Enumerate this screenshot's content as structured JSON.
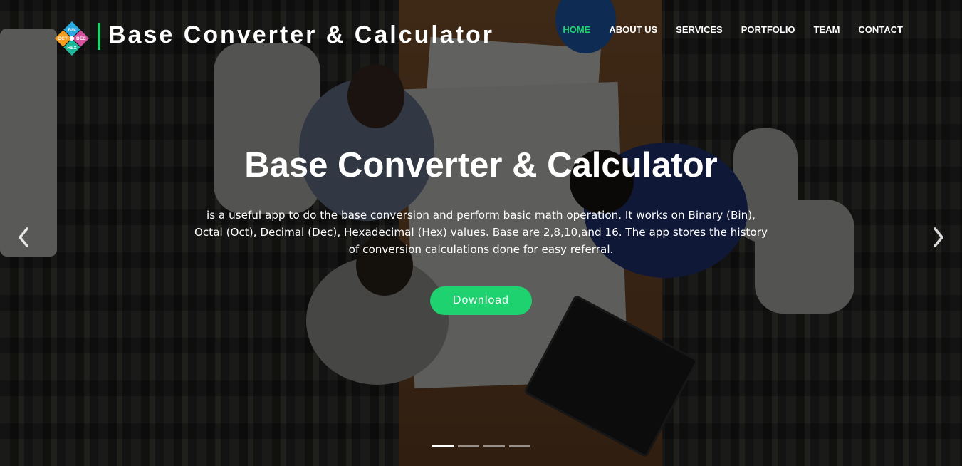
{
  "header": {
    "brand": "Base Converter & Calculator",
    "logo": {
      "labels": [
        "BIN",
        "OCT",
        "DEC",
        "HEX"
      ],
      "colors": [
        "#29a9e1",
        "#f39c1e",
        "#d4509b",
        "#1bb89a"
      ]
    },
    "accent_color": "#1ed36f"
  },
  "nav": {
    "items": [
      {
        "label": "HOME",
        "active": true
      },
      {
        "label": "ABOUT US",
        "active": false
      },
      {
        "label": "SERVICES",
        "active": false
      },
      {
        "label": "PORTFOLIO",
        "active": false
      },
      {
        "label": "TEAM",
        "active": false
      },
      {
        "label": "CONTACT",
        "active": false
      }
    ]
  },
  "hero": {
    "title": "Base Converter & Calculator",
    "description": "is a useful app to do the base conversion and perform basic math operation. It works on Binary (Bin), Octal (Oct), Decimal (Dec), Hexadecimal (Hex) values. Base are 2,8,10,and 16. The app stores the history of conversion calculations done for easy referral.",
    "button_label": "Download",
    "prev_icon": "chevron-left-icon",
    "next_icon": "chevron-right-icon",
    "slides": 4,
    "active_slide": 1
  }
}
